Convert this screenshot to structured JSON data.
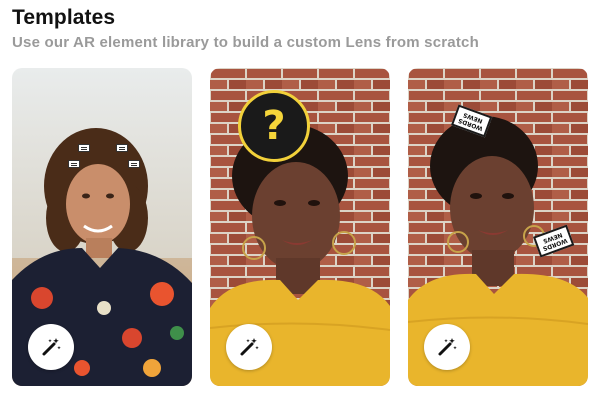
{
  "header": {
    "title": "Templates",
    "subtitle": "Use our AR element library to build a custom Lens from scratch"
  },
  "templates": [
    {
      "name": "Curly hair man in floral shirt",
      "action_icon": "magic-wand-icon",
      "overlay": "face-tracker-chips"
    },
    {
      "name": "Woman with question bubble",
      "action_icon": "magic-wand-icon",
      "overlay": "question-bubble",
      "overlay_text": "?"
    },
    {
      "name": "Woman with floating tags",
      "action_icon": "magic-wand-icon",
      "overlay": "upside-down-tags",
      "tags": [
        {
          "line1": "WORDS",
          "line2": "NEWS"
        },
        {
          "line1": "WORDS",
          "line2": "NEWS"
        }
      ]
    }
  ],
  "colors": {
    "title": "#111111",
    "subtitle": "#9a9a9a",
    "accent_yellow": "#f2d13a",
    "sweater_yellow": "#e9b52c",
    "brick": "#a8543f"
  }
}
